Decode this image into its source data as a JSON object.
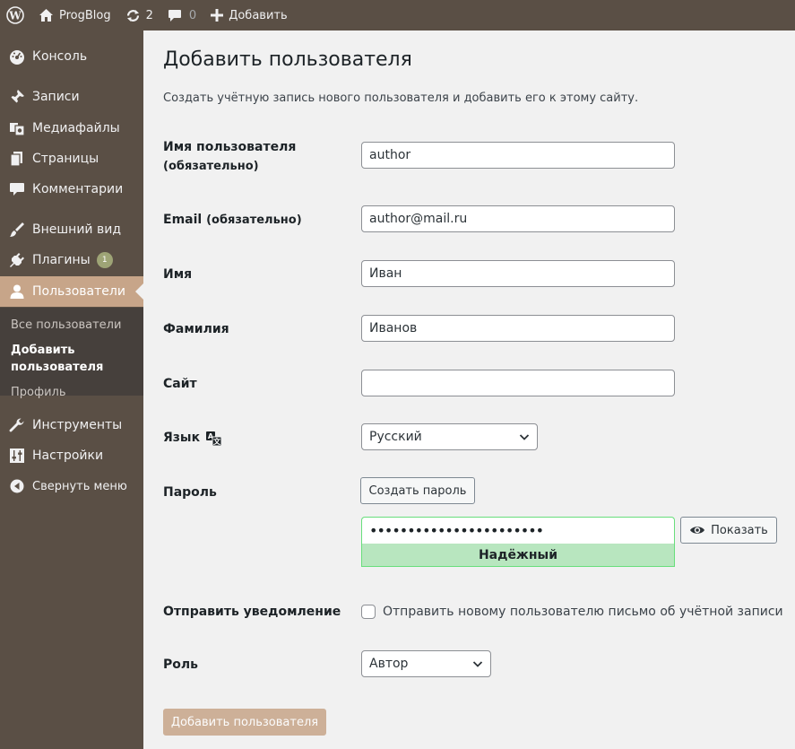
{
  "adminbar": {
    "site_name": "ProgBlog",
    "updates_count": "2",
    "comments_count": "0",
    "new_label": "Добавить"
  },
  "sidebar": {
    "items": [
      {
        "label": "Консоль",
        "icon": "dashboard-icon"
      },
      {
        "label": "Записи",
        "icon": "pin-icon"
      },
      {
        "label": "Медиафайлы",
        "icon": "media-icon"
      },
      {
        "label": "Страницы",
        "icon": "pages-icon"
      },
      {
        "label": "Комментарии",
        "icon": "comment-icon"
      },
      {
        "label": "Внешний вид",
        "icon": "brush-icon"
      },
      {
        "label": "Плагины",
        "icon": "plugin-icon",
        "badge": "1"
      },
      {
        "label": "Пользователи",
        "icon": "user-icon",
        "current": true
      },
      {
        "label": "Инструменты",
        "icon": "wrench-icon"
      },
      {
        "label": "Настройки",
        "icon": "settings-icon"
      },
      {
        "label": "Свернуть меню",
        "icon": "collapse-icon"
      }
    ],
    "submenu": [
      {
        "label": "Все пользователи"
      },
      {
        "label": "Добавить пользователя",
        "current": true
      },
      {
        "label": "Профиль"
      }
    ]
  },
  "page": {
    "title": "Добавить пользователя",
    "description": "Создать учётную запись нового пользователя и добавить его к этому сайту."
  },
  "form": {
    "required_note": "(обязательно)",
    "username": {
      "label": "Имя пользователя",
      "value": "author"
    },
    "email": {
      "label": "Email",
      "value": "author@mail.ru"
    },
    "first_name": {
      "label": "Имя",
      "value": "Иван"
    },
    "last_name": {
      "label": "Фамилия",
      "value": "Иванов"
    },
    "website": {
      "label": "Сайт",
      "value": ""
    },
    "language": {
      "label": "Язык",
      "selected": "Русский"
    },
    "password": {
      "label": "Пароль",
      "generate_label": "Создать пароль",
      "masked_value": "•••••••••••••••••••••••",
      "show_label": "Показать",
      "strength": "Надёжный"
    },
    "notify": {
      "label": "Отправить уведомление",
      "checkbox_text": "Отправить новому пользователю письмо об учётной записи",
      "checked": false
    },
    "role": {
      "label": "Роль",
      "selected": "Автор"
    },
    "submit_label": "Добавить пользователя"
  },
  "colors": {
    "menu_bg": "#5a4f45",
    "submenu_bg": "#46403c",
    "accent": "#c7a589",
    "badge": "#9ea476",
    "strength_bg": "#b8e6bf",
    "strength_border": "#68de7c"
  }
}
